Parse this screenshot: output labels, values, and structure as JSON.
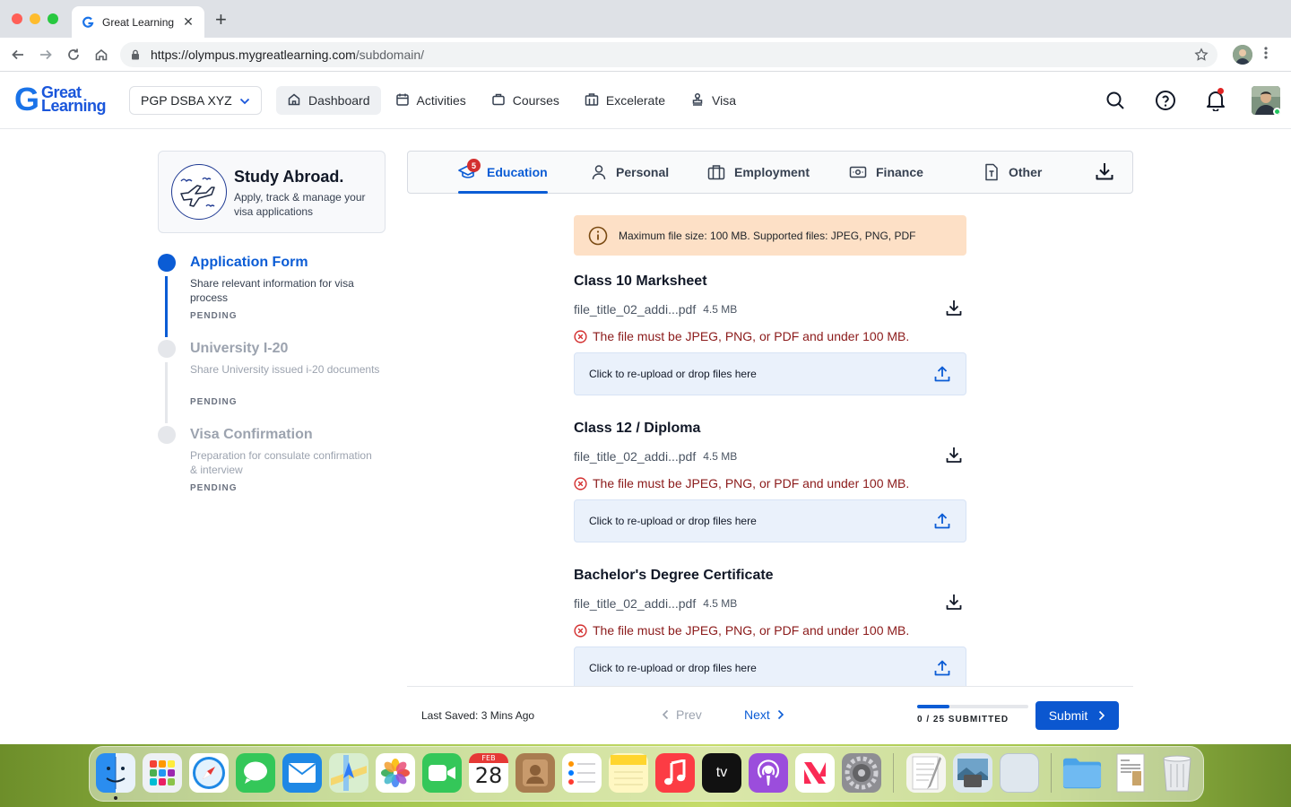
{
  "browser": {
    "tab_title": "Great Learning",
    "tab_close": "✕",
    "new_tab": "+",
    "url_host": "https://olympus.mygreatlearning.com",
    "url_path": "/subdomain/"
  },
  "header": {
    "logo_g": "G",
    "logo_line1": "Great",
    "logo_line2": "Learning",
    "program": "PGP DSBA XYZ",
    "nav": [
      {
        "label": "Dashboard",
        "icon": "home-icon"
      },
      {
        "label": "Activities",
        "icon": "calendar-icon"
      },
      {
        "label": "Courses",
        "icon": "briefcase-icon"
      },
      {
        "label": "Excelerate",
        "icon": "building-icon"
      },
      {
        "label": "Visa",
        "icon": "stamp-icon"
      }
    ],
    "active_nav": "Dashboard"
  },
  "study_card": {
    "title": "Study Abroad.",
    "subtitle": "Apply, track & manage your visa applications"
  },
  "steps": [
    {
      "title": "Application Form",
      "desc": "Share relevant information for visa process",
      "status": "PENDING",
      "active": true
    },
    {
      "title": "University I-20",
      "desc": "Share University issued i-20 documents",
      "status": "PENDING",
      "active": false
    },
    {
      "title": "Visa Confirmation",
      "desc": "Preparation for consulate confirmation & interview",
      "status": "PENDING",
      "active": false
    }
  ],
  "category_tabs": [
    {
      "label": "Education",
      "icon": "graduation-cap-icon",
      "badge": "5",
      "active": true
    },
    {
      "label": "Personal",
      "icon": "person-icon"
    },
    {
      "label": "Employment",
      "icon": "briefcase-icon"
    },
    {
      "label": "Finance",
      "icon": "money-icon"
    },
    {
      "label": "Other",
      "icon": "document-icon"
    }
  ],
  "info_banner": "Maximum file size: 100 MB. Supported files: JPEG, PNG, PDF",
  "documents": [
    {
      "title": "Class 10 Marksheet",
      "file": "file_title_02_addi...pdf",
      "size": "4.5 MB",
      "error": "The file must be JPEG, PNG, or PDF and under 100 MB.",
      "upload": "Click to re-upload or drop files here"
    },
    {
      "title": "Class 12 / Diploma",
      "file": "file_title_02_addi...pdf",
      "size": "4.5 MB",
      "error": "The file must be JPEG, PNG, or PDF and under 100 MB.",
      "upload": "Click to re-upload or drop files here"
    },
    {
      "title": "Bachelor's Degree Certificate",
      "file": "file_title_02_addi...pdf",
      "size": "4.5 MB",
      "error": "The file must be JPEG, PNG, or PDF and under 100 MB.",
      "upload": "Click to re-upload or drop files here"
    }
  ],
  "footer": {
    "last_saved": "Last Saved: 3 Mins Ago",
    "prev": "Prev",
    "next": "Next",
    "progress_label": "0 / 25 SUBMITTED",
    "progress_fraction": 0.29,
    "submit": "Submit"
  },
  "dock": {
    "calendar_month": "FEB",
    "calendar_day": "28",
    "tv_label": "tv",
    "items": [
      "Finder",
      "Launchpad",
      "Safari",
      "Messages",
      "Mail",
      "Maps",
      "Photos",
      "FaceTime",
      "Calendar",
      "Contacts",
      "Reminders",
      "Notes",
      "Music",
      "TV",
      "Podcasts",
      "News",
      "System Preferences",
      "TextEdit",
      "Preview",
      "Window",
      "Folder",
      "Document",
      "Trash"
    ]
  },
  "colors": {
    "brand": "#0b5cd5",
    "error": "#d32f2f",
    "banner": "#fde0c6",
    "dropzone": "#eaf1fb"
  }
}
